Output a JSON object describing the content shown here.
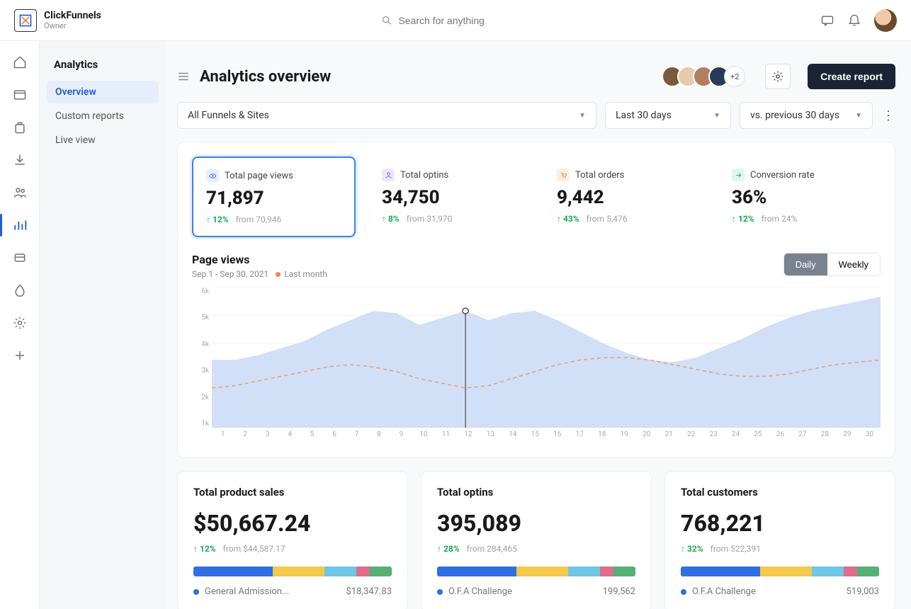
{
  "header": {
    "brand_name": "ClickFunnels",
    "brand_role": "Owner",
    "search_placeholder": "Search for anything"
  },
  "secondary_nav": {
    "title": "Analytics",
    "items": [
      "Overview",
      "Custom reports",
      "Live view"
    ]
  },
  "page": {
    "title": "Analytics overview",
    "avatars_more": "+2",
    "create_button": "Create report"
  },
  "filters": {
    "funnels": "All Funnels & Sites",
    "period": "Last 30 days",
    "compare": "vs. previous 30 days"
  },
  "kpis": [
    {
      "icon_bg": "#e6efff",
      "icon_color": "#2f6fe4",
      "icon": "eye",
      "label": "Total page views",
      "value": "71,897",
      "delta": "12%",
      "from": "from 70,946",
      "active": true
    },
    {
      "icon_bg": "#efe7ff",
      "icon_color": "#7a4ee8",
      "icon": "user",
      "label": "Total optins",
      "value": "34,750",
      "delta": "8%",
      "from": "from 31,970",
      "active": false
    },
    {
      "icon_bg": "#ffeede",
      "icon_color": "#e8853a",
      "icon": "cart",
      "label": "Total orders",
      "value": "9,442",
      "delta": "43%",
      "from": "from 5,476",
      "active": false
    },
    {
      "icon_bg": "#dff6f0",
      "icon_color": "#1fae89",
      "icon": "arrow",
      "label": "Conversion rate",
      "value": "36%",
      "delta": "12%",
      "from": "from 24%",
      "active": false
    }
  ],
  "chart_meta": {
    "title": "Page views",
    "range": "Sep 1 - Sep 30, 2021",
    "legend": "Last month",
    "toggle": [
      "Daily",
      "Weekly"
    ],
    "toggle_active": "Daily"
  },
  "chart_data": {
    "type": "area",
    "xlabel": "",
    "ylabel": "",
    "ylim": [
      0,
      6000
    ],
    "yticks": [
      "6k",
      "5k",
      "4k",
      "3k",
      "2k",
      "1k"
    ],
    "x": [
      1,
      2,
      3,
      4,
      5,
      6,
      7,
      8,
      9,
      10,
      11,
      12,
      13,
      14,
      15,
      16,
      17,
      18,
      19,
      20,
      21,
      22,
      23,
      24,
      25,
      26,
      27,
      28,
      29,
      30
    ],
    "series": [
      {
        "name": "Current",
        "style": "area",
        "color": "#c9d9f6",
        "values": [
          2900,
          2900,
          3100,
          3400,
          3700,
          4200,
          4600,
          5000,
          4900,
          4400,
          4700,
          5000,
          4600,
          4900,
          5000,
          4600,
          4100,
          3600,
          3200,
          2900,
          2800,
          3000,
          3400,
          3800,
          4300,
          4700,
          5000,
          5200,
          5400,
          5600
        ]
      },
      {
        "name": "Last month",
        "style": "dashed",
        "color": "#e7a074",
        "values": [
          1700,
          1800,
          2000,
          2200,
          2400,
          2600,
          2700,
          2600,
          2400,
          2100,
          1900,
          1700,
          1800,
          2100,
          2400,
          2700,
          2900,
          3000,
          3000,
          2900,
          2700,
          2500,
          2300,
          2200,
          2200,
          2300,
          2500,
          2700,
          2800,
          2900
        ]
      }
    ],
    "hover_x": 12
  },
  "bottom_cards": [
    {
      "title": "Total product sales",
      "value": "$50,667.24",
      "delta": "12%",
      "from": "from $44,587.17",
      "segments": [
        {
          "c": "#2f6fe4",
          "w": 40
        },
        {
          "c": "#f3c84b",
          "w": 26
        },
        {
          "c": "#6fc6e6",
          "w": 16
        },
        {
          "c": "#e06b8b",
          "w": 7
        },
        {
          "c": "#54b074",
          "w": 11
        }
      ],
      "row": {
        "dot": "#2f6fe4",
        "name": "General Admission...",
        "val": "$18,347.83"
      }
    },
    {
      "title": "Total optins",
      "value": "395,089",
      "delta": "28%",
      "from": "from 284,465",
      "segments": [
        {
          "c": "#2f6fe4",
          "w": 40
        },
        {
          "c": "#f3c84b",
          "w": 26
        },
        {
          "c": "#6fc6e6",
          "w": 16
        },
        {
          "c": "#e06b8b",
          "w": 7
        },
        {
          "c": "#54b074",
          "w": 11
        }
      ],
      "row": {
        "dot": "#2f6fe4",
        "name": "O.F.A Challenge",
        "val": "199,562"
      }
    },
    {
      "title": "Total customers",
      "value": "768,221",
      "delta": "32%",
      "from": "from 522,391",
      "segments": [
        {
          "c": "#2f6fe4",
          "w": 40
        },
        {
          "c": "#f3c84b",
          "w": 26
        },
        {
          "c": "#6fc6e6",
          "w": 16
        },
        {
          "c": "#e06b8b",
          "w": 7
        },
        {
          "c": "#54b074",
          "w": 11
        }
      ],
      "row": {
        "dot": "#2f6fe4",
        "name": "O.F.A Challenge",
        "val": "519,003"
      }
    }
  ]
}
